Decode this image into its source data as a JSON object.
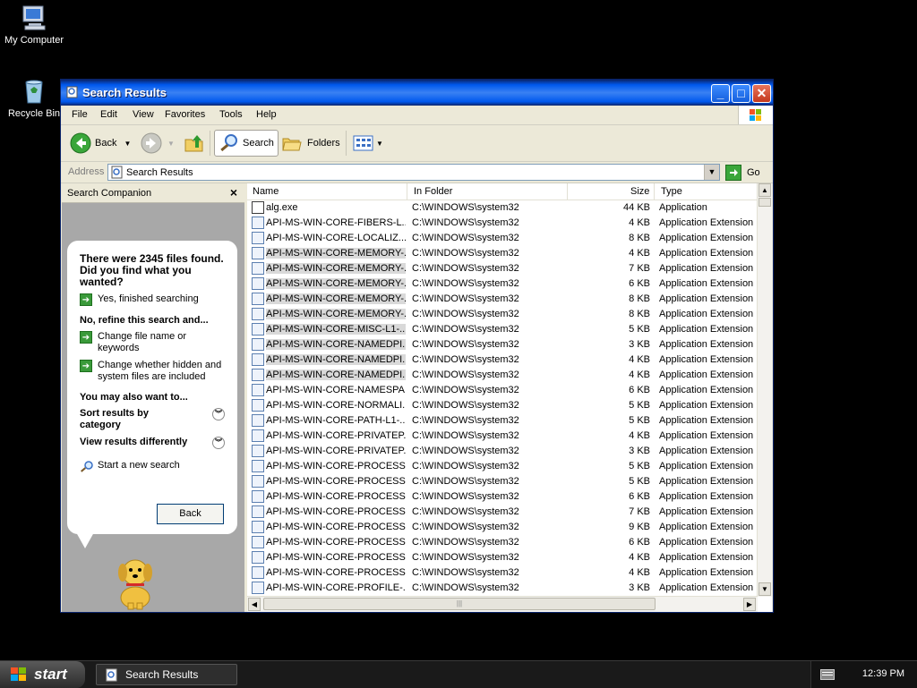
{
  "desktop": {
    "icons": [
      {
        "label": "My Computer"
      },
      {
        "label": "Recycle Bin"
      }
    ]
  },
  "window": {
    "title": "Search Results",
    "menu": [
      "File",
      "Edit",
      "View",
      "Favorites",
      "Tools",
      "Help"
    ],
    "toolbar": {
      "back": "Back",
      "search": "Search",
      "folders": "Folders"
    },
    "address": {
      "label": "Address",
      "value": "Search Results",
      "go": "Go"
    }
  },
  "companion": {
    "title": "Search Companion",
    "found_text": "There were 2345 files found. Did you find what you wanted?",
    "yes": "Yes, finished searching",
    "refine_head": "No, refine this search and...",
    "change_name": "Change file name or keywords",
    "change_hidden": "Change whether hidden and system files are included",
    "also_head": "You may also want to...",
    "sort": "Sort results by category",
    "view": "View results differently",
    "new_search": "Start a new search",
    "back": "Back"
  },
  "list": {
    "columns": {
      "name": "Name",
      "folder": "In Folder",
      "size": "Size",
      "type": "Type"
    },
    "rows": [
      {
        "name": "alg.exe",
        "folder": "C:\\WINDOWS\\system32",
        "size": "44 KB",
        "type": "Application",
        "icon": "exe-icon",
        "selected": false
      },
      {
        "name": "API-MS-WIN-CORE-FIBERS-L...",
        "folder": "C:\\WINDOWS\\system32",
        "size": "4 KB",
        "type": "Application Extension",
        "icon": "dll-icon",
        "selected": false
      },
      {
        "name": "API-MS-WIN-CORE-LOCALIZ...",
        "folder": "C:\\WINDOWS\\system32",
        "size": "8 KB",
        "type": "Application Extension",
        "icon": "dll-icon",
        "selected": false
      },
      {
        "name": "API-MS-WIN-CORE-MEMORY-...",
        "folder": "C:\\WINDOWS\\system32",
        "size": "4 KB",
        "type": "Application Extension",
        "icon": "dll-icon",
        "selected": true
      },
      {
        "name": "API-MS-WIN-CORE-MEMORY-...",
        "folder": "C:\\WINDOWS\\system32",
        "size": "7 KB",
        "type": "Application Extension",
        "icon": "dll-icon",
        "selected": true
      },
      {
        "name": "API-MS-WIN-CORE-MEMORY-...",
        "folder": "C:\\WINDOWS\\system32",
        "size": "6 KB",
        "type": "Application Extension",
        "icon": "dll-icon",
        "selected": true
      },
      {
        "name": "API-MS-WIN-CORE-MEMORY-...",
        "folder": "C:\\WINDOWS\\system32",
        "size": "8 KB",
        "type": "Application Extension",
        "icon": "dll-icon",
        "selected": true
      },
      {
        "name": "API-MS-WIN-CORE-MEMORY-...",
        "folder": "C:\\WINDOWS\\system32",
        "size": "8 KB",
        "type": "Application Extension",
        "icon": "dll-icon",
        "selected": true
      },
      {
        "name": "API-MS-WIN-CORE-MISC-L1-...",
        "folder": "C:\\WINDOWS\\system32",
        "size": "5 KB",
        "type": "Application Extension",
        "icon": "dll-icon",
        "selected": true
      },
      {
        "name": "API-MS-WIN-CORE-NAMEDPI...",
        "folder": "C:\\WINDOWS\\system32",
        "size": "3 KB",
        "type": "Application Extension",
        "icon": "dll-icon",
        "selected": true
      },
      {
        "name": "API-MS-WIN-CORE-NAMEDPI...",
        "folder": "C:\\WINDOWS\\system32",
        "size": "4 KB",
        "type": "Application Extension",
        "icon": "dll-icon",
        "selected": true
      },
      {
        "name": "API-MS-WIN-CORE-NAMEDPI...",
        "folder": "C:\\WINDOWS\\system32",
        "size": "4 KB",
        "type": "Application Extension",
        "icon": "dll-icon",
        "selected": true
      },
      {
        "name": "API-MS-WIN-CORE-NAMESPA...",
        "folder": "C:\\WINDOWS\\system32",
        "size": "6 KB",
        "type": "Application Extension",
        "icon": "dll-icon",
        "selected": false
      },
      {
        "name": "API-MS-WIN-CORE-NORMALI...",
        "folder": "C:\\WINDOWS\\system32",
        "size": "5 KB",
        "type": "Application Extension",
        "icon": "dll-icon",
        "selected": false
      },
      {
        "name": "API-MS-WIN-CORE-PATH-L1-...",
        "folder": "C:\\WINDOWS\\system32",
        "size": "5 KB",
        "type": "Application Extension",
        "icon": "dll-icon",
        "selected": false
      },
      {
        "name": "API-MS-WIN-CORE-PRIVATEP...",
        "folder": "C:\\WINDOWS\\system32",
        "size": "4 KB",
        "type": "Application Extension",
        "icon": "dll-icon",
        "selected": false
      },
      {
        "name": "API-MS-WIN-CORE-PRIVATEP...",
        "folder": "C:\\WINDOWS\\system32",
        "size": "3 KB",
        "type": "Application Extension",
        "icon": "dll-icon",
        "selected": false
      },
      {
        "name": "API-MS-WIN-CORE-PROCESS...",
        "folder": "C:\\WINDOWS\\system32",
        "size": "5 KB",
        "type": "Application Extension",
        "icon": "dll-icon",
        "selected": false
      },
      {
        "name": "API-MS-WIN-CORE-PROCESS...",
        "folder": "C:\\WINDOWS\\system32",
        "size": "5 KB",
        "type": "Application Extension",
        "icon": "dll-icon",
        "selected": false
      },
      {
        "name": "API-MS-WIN-CORE-PROCESS...",
        "folder": "C:\\WINDOWS\\system32",
        "size": "6 KB",
        "type": "Application Extension",
        "icon": "dll-icon",
        "selected": false
      },
      {
        "name": "API-MS-WIN-CORE-PROCESS...",
        "folder": "C:\\WINDOWS\\system32",
        "size": "7 KB",
        "type": "Application Extension",
        "icon": "dll-icon",
        "selected": false
      },
      {
        "name": "API-MS-WIN-CORE-PROCESS...",
        "folder": "C:\\WINDOWS\\system32",
        "size": "9 KB",
        "type": "Application Extension",
        "icon": "dll-icon",
        "selected": false
      },
      {
        "name": "API-MS-WIN-CORE-PROCESS...",
        "folder": "C:\\WINDOWS\\system32",
        "size": "6 KB",
        "type": "Application Extension",
        "icon": "dll-icon",
        "selected": false
      },
      {
        "name": "API-MS-WIN-CORE-PROCESS...",
        "folder": "C:\\WINDOWS\\system32",
        "size": "4 KB",
        "type": "Application Extension",
        "icon": "dll-icon",
        "selected": false
      },
      {
        "name": "API-MS-WIN-CORE-PROCESS...",
        "folder": "C:\\WINDOWS\\system32",
        "size": "4 KB",
        "type": "Application Extension",
        "icon": "dll-icon",
        "selected": false
      },
      {
        "name": "API-MS-WIN-CORE-PROFILE-...",
        "folder": "C:\\WINDOWS\\system32",
        "size": "3 KB",
        "type": "Application Extension",
        "icon": "dll-icon",
        "selected": false
      }
    ]
  },
  "taskbar": {
    "start": "start",
    "task": "Search Results",
    "clock": "12:39 PM"
  },
  "colors": {
    "titlebar": "#0058ee",
    "window_bg": "#ece9d8",
    "companion_bg": "#a8a8a8",
    "desktop": "#000000"
  }
}
